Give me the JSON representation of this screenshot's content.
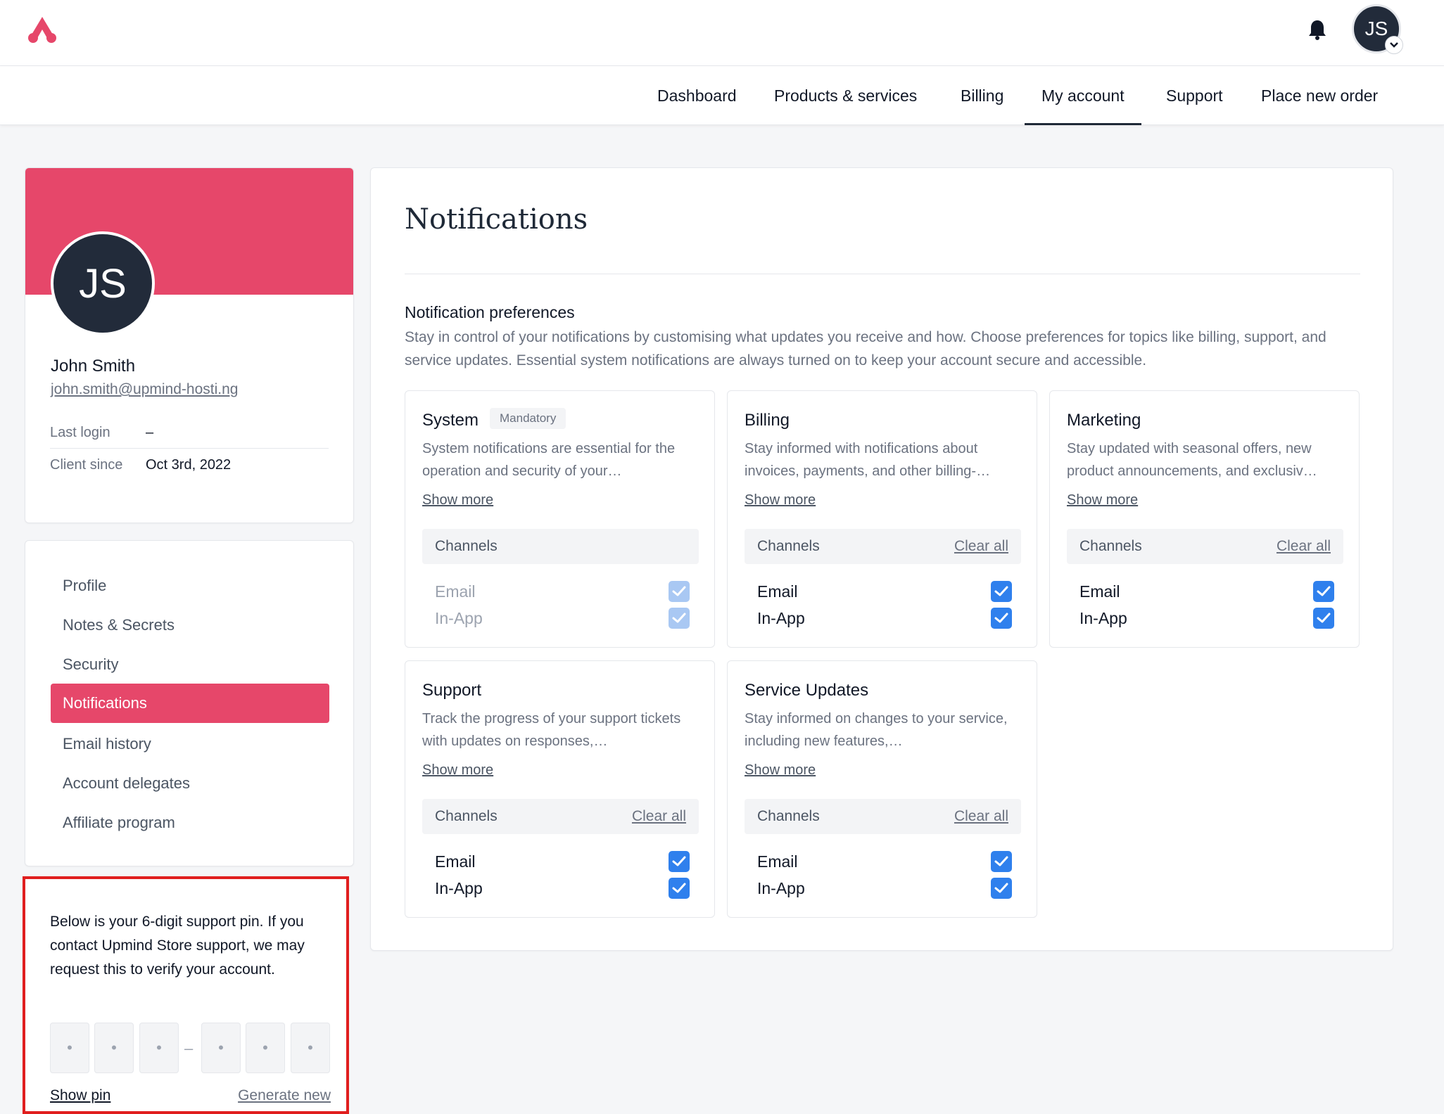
{
  "brand": {
    "accent": "#e6476a",
    "logo_icon": "upmind-logo-icon"
  },
  "header": {
    "notification_icon": "bell-icon",
    "avatar_initials": "JS",
    "avatar_menu_icon": "chevron-down-icon"
  },
  "nav": {
    "items": [
      {
        "label": "Dashboard"
      },
      {
        "label": "Products & services"
      },
      {
        "label": "Billing"
      },
      {
        "label": "My account",
        "active": true
      },
      {
        "label": "Support"
      },
      {
        "label": "Place new order"
      }
    ]
  },
  "profile": {
    "initials": "JS",
    "name": "John Smith",
    "email": "john.smith@upmind-hosti.ng",
    "last_login_label": "Last login",
    "last_login_value": "–",
    "client_since_label": "Client since",
    "client_since_value": "Oct 3rd, 2022"
  },
  "account_menu": {
    "items": [
      {
        "label": "Profile"
      },
      {
        "label": "Notes & Secrets"
      },
      {
        "label": "Security"
      },
      {
        "label": "Notifications",
        "active": true
      },
      {
        "label": "Email history"
      },
      {
        "label": "Account delegates"
      },
      {
        "label": "Affiliate program"
      }
    ]
  },
  "support_pin": {
    "text": "Below is your 6-digit support pin. If you contact Upmind Store support, we may request this to verify your account.",
    "digits": [
      "•",
      "•",
      "•",
      "•",
      "•",
      "•"
    ],
    "separator": "–",
    "show_pin_label": "Show pin",
    "generate_new_label": "Generate new"
  },
  "main": {
    "title": "Notifications",
    "preferences_title": "Notification preferences",
    "preferences_desc": "Stay in control of your notifications by customising what updates you receive and how. Choose preferences for topics like billing, support, and service updates. Essential system notifications are always turned on to keep your account secure and accessible.",
    "show_more_label": "Show more",
    "channels_label": "Channels",
    "clear_all_label": "Clear all",
    "topics": [
      {
        "title": "System",
        "badge": "Mandatory",
        "desc": "System notifications are essential for the operation and security of your…",
        "clear_all": false,
        "channels": [
          {
            "label": "Email",
            "checked": true,
            "disabled": true
          },
          {
            "label": "In-App",
            "checked": true,
            "disabled": true
          }
        ]
      },
      {
        "title": "Billing",
        "badge": "",
        "desc": "Stay informed with notifications about invoices, payments, and other billing-…",
        "clear_all": true,
        "channels": [
          {
            "label": "Email",
            "checked": true,
            "disabled": false
          },
          {
            "label": "In-App",
            "checked": true,
            "disabled": false
          }
        ]
      },
      {
        "title": "Marketing",
        "badge": "",
        "desc": "Stay updated with seasonal offers, new product announcements, and exclusiv…",
        "clear_all": true,
        "channels": [
          {
            "label": "Email",
            "checked": true,
            "disabled": false
          },
          {
            "label": "In-App",
            "checked": true,
            "disabled": false
          }
        ]
      },
      {
        "title": "Support",
        "badge": "",
        "desc": "Track the progress of your support tickets with updates on responses,…",
        "clear_all": true,
        "channels": [
          {
            "label": "Email",
            "checked": true,
            "disabled": false
          },
          {
            "label": "In-App",
            "checked": true,
            "disabled": false
          }
        ]
      },
      {
        "title": "Service Updates",
        "badge": "",
        "desc": "Stay informed on changes to your service, including new features,…",
        "clear_all": true,
        "channels": [
          {
            "label": "Email",
            "checked": true,
            "disabled": false
          },
          {
            "label": "In-App",
            "checked": true,
            "disabled": false
          }
        ]
      }
    ]
  }
}
